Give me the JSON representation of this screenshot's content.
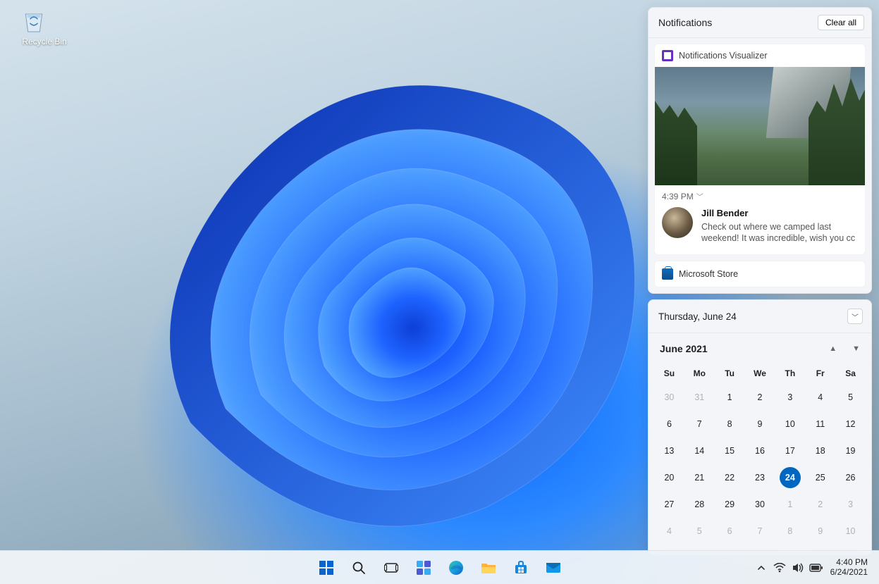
{
  "desktop": {
    "recycle_bin_label": "Recycle Bin"
  },
  "notifications": {
    "title": "Notifications",
    "clear_all": "Clear all",
    "groups": [
      {
        "app_name": "Notifications Visualizer",
        "time": "4:39 PM",
        "sender": "Jill Bender",
        "message": "Check out where we camped last weekend! It was incredible, wish you cc"
      }
    ],
    "secondary_app": "Microsoft Store"
  },
  "calendar": {
    "full_date": "Thursday, June 24",
    "month_label": "June 2021",
    "dow": [
      "Su",
      "Mo",
      "Tu",
      "We",
      "Th",
      "Fr",
      "Sa"
    ],
    "weeks": [
      [
        {
          "d": "30",
          "m": true
        },
        {
          "d": "31",
          "m": true
        },
        {
          "d": "1"
        },
        {
          "d": "2"
        },
        {
          "d": "3"
        },
        {
          "d": "4"
        },
        {
          "d": "5"
        }
      ],
      [
        {
          "d": "6"
        },
        {
          "d": "7"
        },
        {
          "d": "8"
        },
        {
          "d": "9"
        },
        {
          "d": "10"
        },
        {
          "d": "11"
        },
        {
          "d": "12"
        }
      ],
      [
        {
          "d": "13"
        },
        {
          "d": "14"
        },
        {
          "d": "15"
        },
        {
          "d": "16"
        },
        {
          "d": "17"
        },
        {
          "d": "18"
        },
        {
          "d": "19"
        }
      ],
      [
        {
          "d": "20"
        },
        {
          "d": "21"
        },
        {
          "d": "22"
        },
        {
          "d": "23"
        },
        {
          "d": "24",
          "today": true
        },
        {
          "d": "25"
        },
        {
          "d": "26"
        }
      ],
      [
        {
          "d": "27"
        },
        {
          "d": "28"
        },
        {
          "d": "29"
        },
        {
          "d": "30"
        },
        {
          "d": "1",
          "m": true
        },
        {
          "d": "2",
          "m": true
        },
        {
          "d": "3",
          "m": true
        }
      ],
      [
        {
          "d": "4",
          "m": true
        },
        {
          "d": "5",
          "m": true
        },
        {
          "d": "6",
          "m": true
        },
        {
          "d": "7",
          "m": true
        },
        {
          "d": "8",
          "m": true
        },
        {
          "d": "9",
          "m": true
        },
        {
          "d": "10",
          "m": true
        }
      ]
    ]
  },
  "taskbar": {
    "clock_time": "4:40 PM",
    "clock_date": "6/24/2021"
  }
}
